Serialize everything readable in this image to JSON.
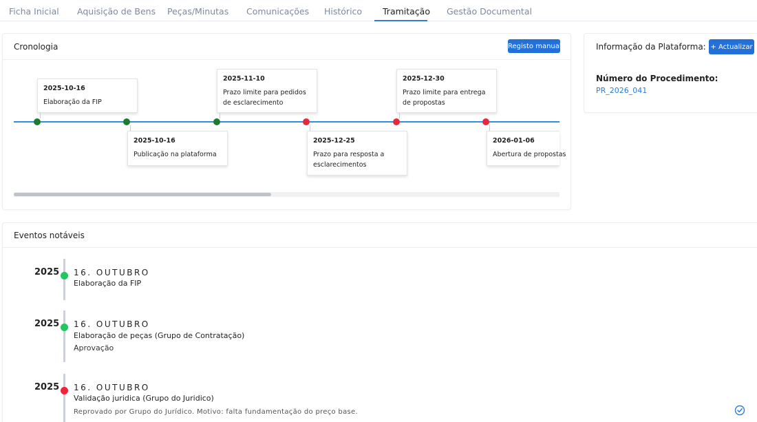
{
  "tabs": [
    {
      "label": "Ficha Inicial"
    },
    {
      "label": "Aquisição de Bens"
    },
    {
      "label": "Peças/Minutas"
    },
    {
      "label": "Comunicações"
    },
    {
      "label": "Histórico"
    },
    {
      "label": "Tramitação",
      "active": true
    },
    {
      "label": "Gestão Documental"
    }
  ],
  "cronologia": {
    "title": "Cronologia",
    "manual_button": "Registo manual",
    "events": [
      {
        "date": "2025-10-16",
        "label": "Elaboração da FIP",
        "status": "green"
      },
      {
        "date": "2025-10-16",
        "label": "Publicação na plataforma",
        "status": "green"
      },
      {
        "date": "2025-11-10",
        "label": "Prazo limite para pedidos de esclarecimento",
        "status": "green"
      },
      {
        "date": "2025-12-25",
        "label": "Prazo para resposta a esclarecimentos",
        "status": "red"
      },
      {
        "date": "2025-12-30",
        "label": "Prazo limite para entrega de propostas",
        "status": "red"
      },
      {
        "date": "2026-01-06",
        "label": "Abertura de propostas",
        "status": "red"
      }
    ]
  },
  "platform_info": {
    "title": "Informação da Plataforma:",
    "refresh_button": "+ Actualizar",
    "procedure_label": "Número do Procedimento:",
    "procedure_value": "PR_2026_041"
  },
  "notable_events": {
    "title": "Eventos notáveis",
    "items": [
      {
        "year": "2025",
        "day": "16. OUTUBRO",
        "title": "Elaboração da FIP",
        "note": "",
        "status": "green"
      },
      {
        "year": "2025",
        "day": "16. OUTUBRO",
        "title": "Elaboração de peças (Grupo de Contratação)",
        "note": "Aprovação",
        "status": "green"
      },
      {
        "year": "2025",
        "day": "16. OUTUBRO",
        "title": "Validação juridica (Grupo do Juridico)",
        "note": "Reprovado por Grupo do Jurídico. Motivo: falta fundamentação do preço base.",
        "status": "red"
      }
    ]
  },
  "colors": {
    "accent": "#2370d8",
    "line": "#2e8fe0",
    "green_dark": "#1d7a2e",
    "green": "#22c55e",
    "red": "#e6293f"
  },
  "icons": {
    "check": "check-circle-icon"
  }
}
